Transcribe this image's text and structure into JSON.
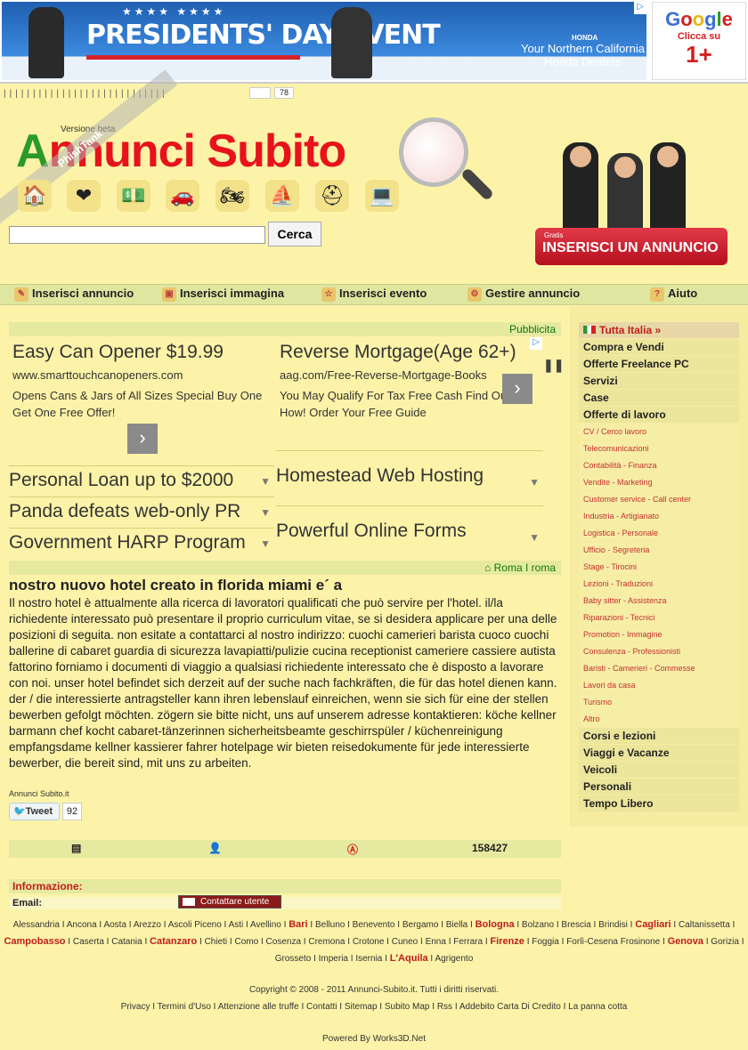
{
  "banner": {
    "honda_title": "PRESIDENTS' DAY EVENT",
    "honda_brand": "HONDA",
    "honda_dealers": "Your Northern California Honda Dealers",
    "google": "Google",
    "google_clicca": "Clicca su",
    "google_plus": "1+"
  },
  "toolbar": {
    "count": "78"
  },
  "header": {
    "version": "Versione beta",
    "logo": "Annunci Subito",
    "search_placeholder": "",
    "search_button": "Cerca",
    "cta_small": "Gratis",
    "cta_label": "INSERISCI UN ANNUNCIO",
    "watermark": "PhishTank"
  },
  "categories": [
    "house-icon",
    "heart-icon",
    "money-icon",
    "car-icon",
    "motorbike-icon",
    "boat-icon",
    "helmet-icon",
    "computer-icon"
  ],
  "nav": [
    {
      "label": "Inserisci annuncio"
    },
    {
      "label": "Inserisci immagina"
    },
    {
      "label": "Inserisci evento"
    },
    {
      "label": "Gestire annuncio"
    },
    {
      "label": "Aiuto"
    }
  ],
  "ads": {
    "pubblicita": "Pubblicita",
    "ad1": {
      "title": "Easy Can Opener $19.99",
      "url": "www.smarttouchcanopeners.com",
      "desc": "Opens Cans & Jars of All Sizes Special Buy One Get One Free Offer!"
    },
    "ad2": {
      "title": "Reverse Mortgage(Age 62+)",
      "url": "aag.com/Free-Reverse-Mortgage-Books",
      "desc": "You May Qualify For Tax Free Cash Find Out How! Order Your Free Guide"
    },
    "links_left": [
      "Personal Loan up to $2000",
      "Panda defeats web-only PR",
      "Government HARP Program"
    ],
    "links_right": [
      "Homestead Web Hosting",
      "Powerful Online Forms"
    ]
  },
  "breadcrumb": {
    "city": "Roma",
    "sep": "I",
    "sub": "roma"
  },
  "article": {
    "title": "nostro nuovo hotel creato in florida miami e´ a",
    "body": "Il nostro hotel è attualmente alla ricerca di lavoratori qualificati che può servire per l'hotel. il/la richiedente interessato può presentare il proprio curriculum vitae, se si desidera applicare per una delle posizioni di seguita. non esitate a contattarci al nostro indirizzo: cuochi camerieri barista cuoco cuochi ballerine di cabaret guardia di sicurezza lavapiatti/pulizie cucina receptionist cameriere cassiere autista fattorino forniamo i documenti di viaggio a qualsiasi richiedente interessato che è disposto a lavorare con noi. unser hotel befindet sich derzeit auf der suche nach fachkräften, die für das hotel dienen kann. der / die interessierte antragsteller kann ihren lebenslauf einreichen, wenn sie sich für eine der stellen bewerben gefolgt möchten. zögern sie bitte nicht, uns auf unserem adresse kontaktieren: köche kellner barmann chef kocht cabaret-tänzerinnen sicherheitsbeamte geschirrspüler / küchenreinigung empfangsdame kellner kassierer fahrer hotelpage wir bieten reisedokumente für jede interessierte bewerber, die bereit sind, mit uns zu arbeiten.",
    "site": "Annunci Subito.it",
    "tweet": "Tweet",
    "tweet_count": "92"
  },
  "stats": {
    "views": "158427"
  },
  "info": {
    "label": "Informazione:",
    "email": "Email:",
    "contact": "Contattare utente"
  },
  "sidebar": {
    "top": "Tutta Italia »",
    "items": [
      {
        "label": "Compra e Vendi",
        "sub": false
      },
      {
        "label": "Offerte Freelance PC",
        "sub": false
      },
      {
        "label": "Servizi",
        "sub": false
      },
      {
        "label": "Case",
        "sub": false
      },
      {
        "label": "Offerte di lavoro",
        "sub": false
      },
      {
        "label": "CV / Cerco lavoro",
        "sub": true
      },
      {
        "label": "Telecomunicazioni",
        "sub": true
      },
      {
        "label": "Contabilità - Finanza",
        "sub": true
      },
      {
        "label": "Vendite - Marketing",
        "sub": true
      },
      {
        "label": "Customer service - Call center",
        "sub": true
      },
      {
        "label": "Industria - Artigianato",
        "sub": true
      },
      {
        "label": "Logistica - Personale",
        "sub": true
      },
      {
        "label": "Ufficio - Segreteria",
        "sub": true
      },
      {
        "label": "Stage - Tirocini",
        "sub": true
      },
      {
        "label": "Lezioni - Traduzioni",
        "sub": true
      },
      {
        "label": "Baby sitter - Assistenza",
        "sub": true
      },
      {
        "label": "Riparazioni - Tecnici",
        "sub": true
      },
      {
        "label": "Promotion - Immagine",
        "sub": true
      },
      {
        "label": "Consulenza - Professionisti",
        "sub": true
      },
      {
        "label": "Baristi - Camerieri - Commesse",
        "sub": true
      },
      {
        "label": "Lavori da casa",
        "sub": true
      },
      {
        "label": "Turismo",
        "sub": true
      },
      {
        "label": "Altro",
        "sub": true
      },
      {
        "label": "Corsi e lezioni",
        "sub": false
      },
      {
        "label": "Viaggi e Vacanze",
        "sub": false
      },
      {
        "label": "Veicoli",
        "sub": false
      },
      {
        "label": "Personali",
        "sub": false
      },
      {
        "label": "Tempo Libero",
        "sub": false
      }
    ]
  },
  "cities": [
    {
      "n": "Alessandria",
      "b": false
    },
    {
      "n": "Ancona",
      "b": false
    },
    {
      "n": "Aosta",
      "b": false
    },
    {
      "n": "Arezzo",
      "b": false
    },
    {
      "n": "Ascoli Piceno",
      "b": false
    },
    {
      "n": "Asti",
      "b": false
    },
    {
      "n": "Avellino",
      "b": false
    },
    {
      "n": "Bari",
      "b": true
    },
    {
      "n": "Belluno",
      "b": false
    },
    {
      "n": "Benevento",
      "b": false
    },
    {
      "n": "Bergamo",
      "b": false
    },
    {
      "n": "Biella",
      "b": false
    },
    {
      "n": "Bologna",
      "b": true
    },
    {
      "n": "Bolzano",
      "b": false
    },
    {
      "n": "Brescia",
      "b": false
    },
    {
      "n": "Brindisi",
      "b": false
    },
    {
      "n": "Cagliari",
      "b": true
    },
    {
      "n": "Caltanissetta",
      "b": false
    },
    {
      "n": "Campobasso",
      "b": true
    },
    {
      "n": "Caserta",
      "b": false
    },
    {
      "n": "Catania",
      "b": false
    },
    {
      "n": "Catanzaro",
      "b": true
    },
    {
      "n": "Chieti",
      "b": false
    },
    {
      "n": "Como",
      "b": false
    },
    {
      "n": "Cosenza",
      "b": false
    },
    {
      "n": "Cremona",
      "b": false
    },
    {
      "n": "Crotone",
      "b": false
    },
    {
      "n": "Cuneo",
      "b": false
    },
    {
      "n": "Enna",
      "b": false
    },
    {
      "n": "Ferrara",
      "b": false
    },
    {
      "n": "Firenze",
      "b": true
    },
    {
      "n": "Foggia",
      "b": false
    },
    {
      "n": "Forlì-Cesena Frosinone",
      "b": false
    },
    {
      "n": "Genova",
      "b": true
    },
    {
      "n": "Gorizia",
      "b": false
    },
    {
      "n": "Grosseto",
      "b": false
    },
    {
      "n": "Imperia",
      "b": false
    },
    {
      "n": "Isernia",
      "b": false
    },
    {
      "n": "L'Aquila",
      "b": true
    },
    {
      "n": "Agrigento",
      "b": false
    }
  ],
  "footer": {
    "copyright": "Copyright © 2008 - 2011 Annunci-Subito.it. Tutti i diritti riservati.",
    "links": [
      "Privacy",
      "Termini d'Uso",
      "Attenzione alle truffe",
      "Contatti",
      "Sitemap",
      "Subito Map",
      "Rss",
      "Addebito Carta Di Credito",
      "La panna cotta"
    ],
    "powered": "Powered By Works3D.Net"
  }
}
